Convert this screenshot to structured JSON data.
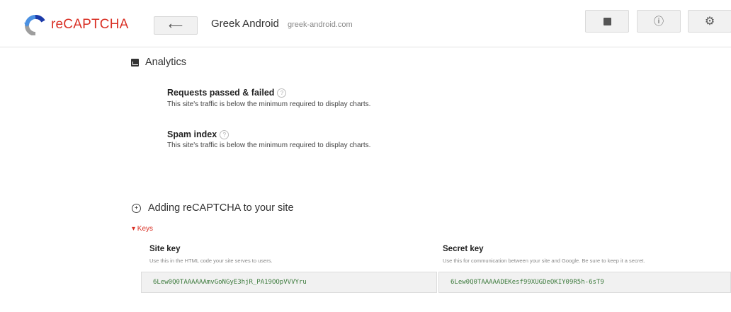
{
  "app": {
    "logo_text": "reCAPTCHA"
  },
  "header": {
    "back_label": "⟵",
    "site_name": "Greek Android",
    "site_domain": "greek-android.com",
    "buttons": [
      {
        "icon": "analytics-icon"
      },
      {
        "icon": "info-icon",
        "label": "ⓘ"
      },
      {
        "icon": "gear-icon",
        "label": "⚙"
      }
    ]
  },
  "analytics": {
    "title": "Analytics",
    "metrics": [
      {
        "title": "Requests passed & failed",
        "help": "?",
        "desc": "This site's traffic is below the minimum required to display charts."
      },
      {
        "title": "Spam index",
        "help": "?",
        "desc": "This site's traffic is below the minimum required to display charts."
      }
    ]
  },
  "adding": {
    "title": "Adding reCAPTCHA to your site",
    "icon_glyph": "+",
    "keys_toggle": "▾ Keys",
    "site_key": {
      "label": "Site key",
      "help": "Use this in the HTML code your site serves to users.",
      "value": "6Lew0Q0TAAAAAAmvGoNGyE3hjR_PA19OOpVVVYru"
    },
    "secret_key": {
      "label": "Secret key",
      "help": "Use this for communication between your site and Google. Be sure to keep it a secret.",
      "value": "6Lew0Q0TAAAAADEKesf99XUGDeOKIY09R5h-6sT9"
    }
  },
  "colors": {
    "brand": "#d93025",
    "key_text": "#3c7a3c"
  }
}
